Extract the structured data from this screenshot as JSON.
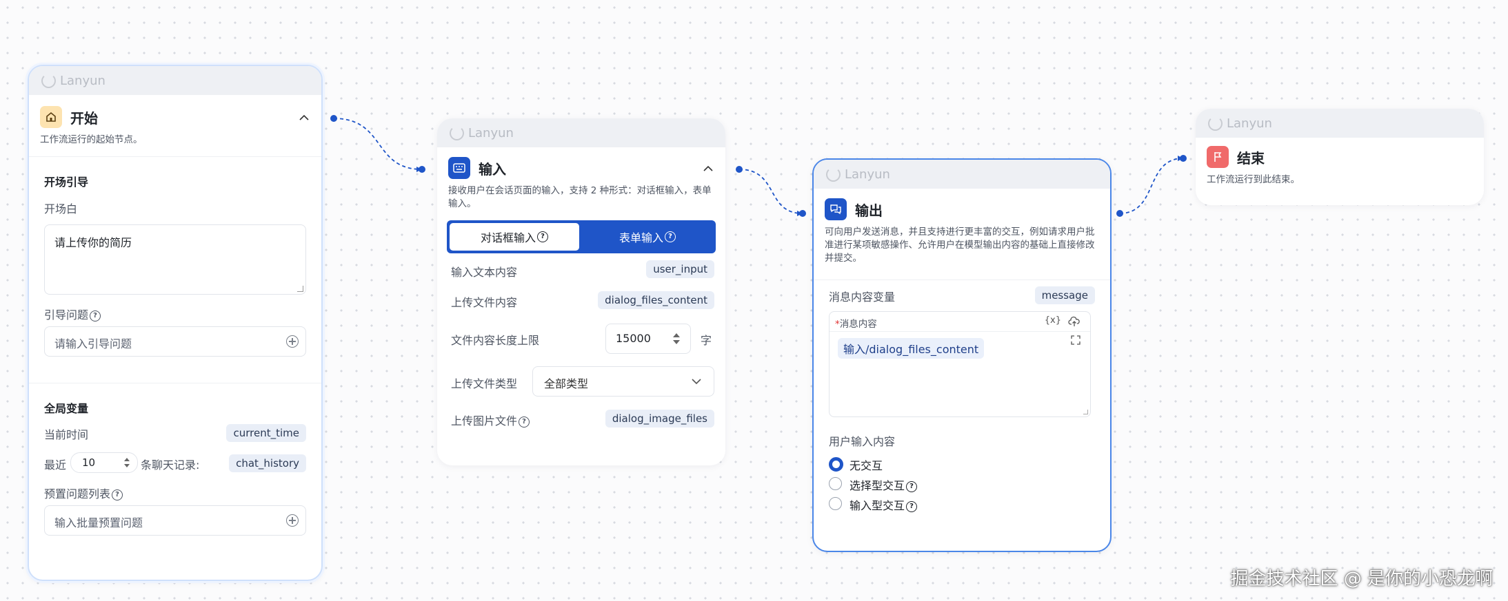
{
  "brand": "Lanyun",
  "nodes": {
    "start": {
      "title": "开始",
      "desc": "工作流运行的起始节点。",
      "opening_section": "开场引导",
      "opening_label": "开场白",
      "opening_value": "请上传你的简历",
      "guide_label": "引导问题",
      "guide_placeholder": "请输入引导问题",
      "globals_section": "全局变量",
      "current_time_label": "当前时间",
      "current_time_var": "current_time",
      "recent_prefix": "最近",
      "recent_count": "10",
      "recent_suffix": "条聊天记录:",
      "chat_history_var": "chat_history",
      "preset_label": "预置问题列表",
      "preset_placeholder": "输入批量预置问题"
    },
    "input": {
      "title": "输入",
      "desc": "接收用户在会话页面的输入，支持 2 种形式：对话框输入，表单输入。",
      "tab_dialog": "对话框输入",
      "tab_form": "表单输入",
      "text_label": "输入文本内容",
      "text_var": "user_input",
      "file_label": "上传文件内容",
      "file_var": "dialog_files_content",
      "limit_label": "文件内容长度上限",
      "limit_value": "15000",
      "limit_unit": "字",
      "type_label": "上传文件类型",
      "type_value": "全部类型",
      "image_label": "上传图片文件",
      "image_var": "dialog_image_files"
    },
    "output": {
      "title": "输出",
      "desc": "可向用户发送消息，并且支持进行更丰富的交互，例如请求用户批准进行某项敏感操作、允许用户在模型输出内容的基础上直接修改并提交。",
      "msg_var_label": "消息内容变量",
      "msg_var": "message",
      "msg_content_label": "消息内容",
      "var_button": "{x}",
      "msg_chip": "输入/dialog_files_content",
      "user_input_label": "用户输入内容",
      "options": [
        "无交互",
        "选择型交互",
        "输入型交互"
      ],
      "selected_option": "无交互"
    },
    "end": {
      "title": "结束",
      "desc": "工作流运行到此结束。"
    }
  },
  "watermark": "掘金技术社区 @ 是你的小恐龙啊",
  "colors": {
    "accent": "#1f55c8",
    "start_icon_bg": "#fde3b0",
    "end_icon_bg": "#f06a6a",
    "edge": "#1f55c8"
  }
}
